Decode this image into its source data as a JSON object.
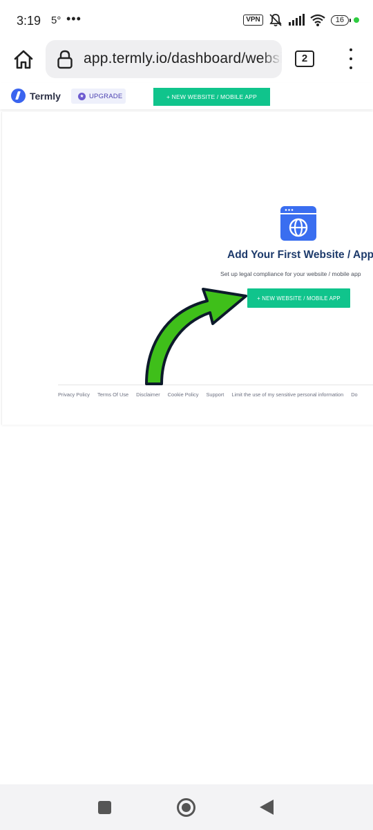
{
  "status_bar": {
    "time": "3:19",
    "temperature": "5°",
    "more": "•••",
    "vpn": "VPN",
    "battery": "16",
    "indicator_color": "#2ecc40"
  },
  "browser": {
    "url": "app.termly.io/dashboard/websi",
    "tab_count": "2",
    "icons": [
      "home-icon",
      "lock-icon",
      "tabs-icon",
      "more-vert-icon"
    ]
  },
  "header": {
    "brand": "Termly",
    "upgrade_label": "UPGRADE",
    "new_button_label": "+ NEW WEBSITE / MOBILE APP",
    "accent_color": "#10c48c",
    "brand_color": "#3a64ef"
  },
  "empty_state": {
    "icon": "website-globe-icon",
    "title": "Add Your First Website / App",
    "subtitle": "Set up legal compliance for your website / mobile app",
    "button_label": "+ NEW WEBSITE / MOBILE APP"
  },
  "footer": {
    "links": [
      "Privacy Policy",
      "Terms Of Use",
      "Disclaimer",
      "Cookie Policy",
      "Support",
      "Limit the use of my sensitive personal information",
      "Do"
    ]
  },
  "annotation": {
    "arrow_color": "#3fbf1a"
  },
  "nav": {
    "icons": [
      "recents-icon",
      "home-circle-icon",
      "back-icon"
    ]
  }
}
